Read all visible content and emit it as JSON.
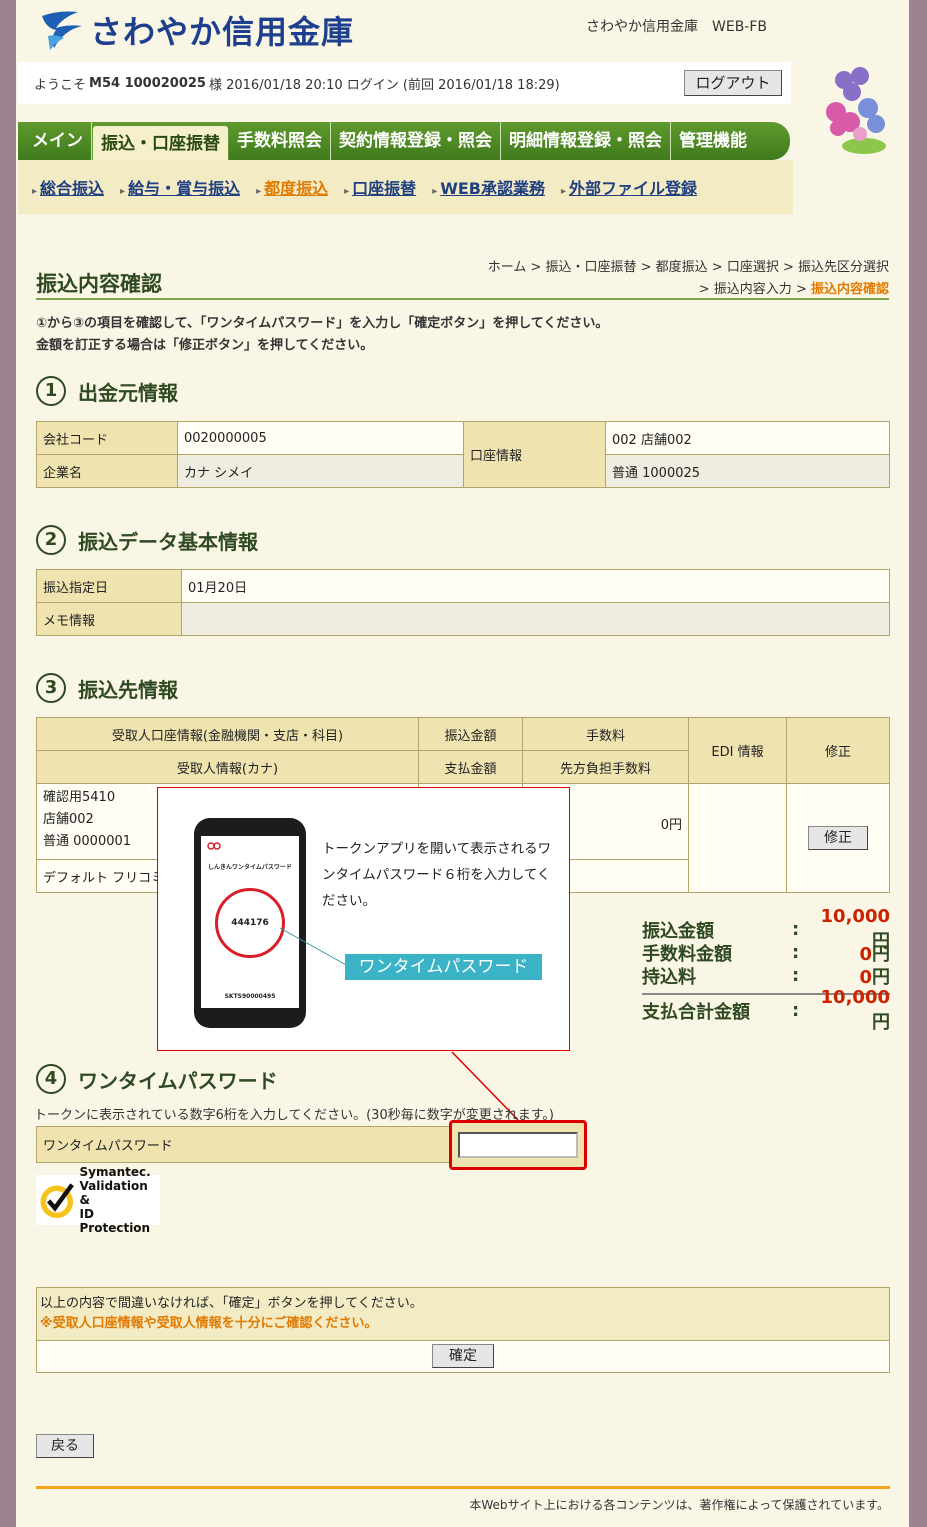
{
  "header": {
    "bank_name": "さわやか信用金庫",
    "bank_code": "さわやか信用金庫　WEB-FB",
    "welcome_prefix": "ようこそ",
    "user_id": "M54 100020025",
    "welcome_suffix": "様 2016/01/18 20:10 ログイン (前回 2016/01/18 18:29)",
    "logout_label": "ログアウト"
  },
  "mainnav": [
    "メイン",
    "振込・口座振替",
    "手数料照会",
    "契約情報登録・照会",
    "明細情報登録・照会",
    "管理機能"
  ],
  "subnav": [
    "総合振込",
    "給与・賞与振込",
    "都度振込",
    "口座振替",
    "WEB承認業務",
    "外部ファイル登録"
  ],
  "breadcrumb": {
    "line1": "ホーム > 振込・口座振替 > 都度振込 > 口座選択 > 振込先区分選択",
    "line2_prefix": "> 振込内容入力 >",
    "line2_current": "振込内容確認"
  },
  "page_title": "振込内容確認",
  "instructions": {
    "line1": "①から③の項目を確認して、「ワンタイムパスワード」を入力し「確定ボタン」を押してください。",
    "line2": "金額を訂正する場合は「修正ボタン」を押してください。"
  },
  "section1": {
    "num": "1",
    "title": "出金元情報",
    "company_code_label": "会社コード",
    "company_code": "0020000005",
    "company_name_label": "企業名",
    "company_name": "カナ シメイ",
    "account_label": "口座情報",
    "branch": "002 店舗002",
    "account": "普通 1000025"
  },
  "section2": {
    "num": "2",
    "title": "振込データ基本情報",
    "date_label": "振込指定日",
    "date": "01月20日",
    "memo_label": "メモ情報",
    "memo": ""
  },
  "section3": {
    "num": "3",
    "title": "振込先情報",
    "headers": {
      "recipient_account": "受取人口座情報(金融機関・支店・科目)",
      "transfer_amount": "振込金額",
      "fee": "手数料",
      "edi": "EDI 情報",
      "fix": "修正",
      "recipient_name": "受取人情報(カナ)",
      "payment_amount": "支払金額",
      "payer_fee": "先方負担手数料"
    },
    "row": {
      "bank": "確認用5410",
      "branch": "店舗002",
      "account": "普通 0000001",
      "name": "デフォルト フリコミサキ",
      "fee": "0円",
      "fix_label": "修正"
    }
  },
  "totals": [
    {
      "label": "振込金額",
      "value": "10,000",
      "unit": "円"
    },
    {
      "label": "手数料金額",
      "value": "0",
      "unit": "円"
    },
    {
      "label": "持込料",
      "value": "0",
      "unit": "円"
    },
    {
      "label": "支払合計金額",
      "value": "10,000",
      "unit": "円"
    }
  ],
  "popup": {
    "app_title": "しんきんワンタイムパスワード",
    "code": "444176",
    "serial": "SKTS90000495",
    "description": "トークンアプリを開いて表示されるワンタイムパスワード６桁を入力してください。",
    "tag": "ワンタイムパスワード"
  },
  "section4": {
    "num": "4",
    "title": "ワンタイムパスワード",
    "note": "トークンに表示されている数字6桁を入力してください。(30秒毎に数字が変更されます。)",
    "field_label": "ワンタイムパスワード",
    "field_value": ""
  },
  "symantec": {
    "line1": "Symantec.",
    "line2": "Validation &",
    "line3": "ID Protection"
  },
  "confirm": {
    "message": "以上の内容で間違いなければ、「確定」ボタンを押してください。",
    "warning": "※受取人口座情報や受取人情報を十分にご確認ください。",
    "button": "確定"
  },
  "back_label": "戻る",
  "footer": "本Webサイト上における各コンテンツは、著作権によって保護されています。",
  "colors": {
    "brand": "#1d3f8e",
    "nav_green": "#4a8a22",
    "accent_orange": "#e07a00",
    "alert_red": "#cc2200"
  }
}
